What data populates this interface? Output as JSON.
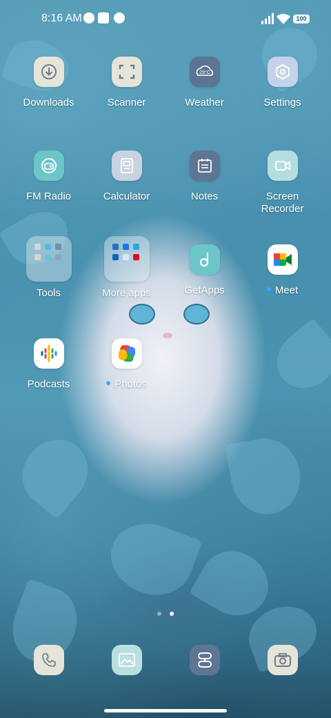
{
  "status_bar": {
    "time": "8:16 AM",
    "battery": "100",
    "icons": [
      "notification-circle-icon",
      "notification-square-icon",
      "notification-circle-icon",
      "signal-icon",
      "wifi-icon",
      "battery-icon"
    ]
  },
  "apps": [
    {
      "label": "Downloads",
      "icon": "download-icon",
      "bg": "#e5e4d8"
    },
    {
      "label": "Scanner",
      "icon": "scanner-icon",
      "bg": "#e5e4d8"
    },
    {
      "label": "Weather",
      "icon": "weather-icon",
      "bg": "#5d7592",
      "temp": "29°C"
    },
    {
      "label": "Settings",
      "icon": "settings-icon",
      "bg": "#c5d2ea"
    },
    {
      "label": "FM Radio",
      "icon": "radio-icon",
      "bg": "#6cc5c8"
    },
    {
      "label": "Calculator",
      "icon": "calculator-icon",
      "bg": "#c9d2e0"
    },
    {
      "label": "Notes",
      "icon": "notes-icon",
      "bg": "#5e7594"
    },
    {
      "label": "Screen Recorder",
      "label_line1": "Screen",
      "label_line2": "Recorder",
      "icon": "screen-recorder-icon",
      "bg": "#b5dde0"
    },
    {
      "label": "Tools",
      "icon": "tools-folder-icon"
    },
    {
      "label": "More apps",
      "icon": "more-apps-folder-icon"
    },
    {
      "label": "GetApps",
      "icon": "getapps-icon",
      "bg": "#6cc5c8"
    },
    {
      "label": "Meet",
      "icon": "google-meet-icon",
      "bg": "#ffffff",
      "new_dot": true
    },
    {
      "label": "Podcasts",
      "icon": "google-podcasts-icon",
      "bg": "#ffffff"
    },
    {
      "label": "Photos",
      "icon": "google-photos-icon",
      "bg": "#ffffff",
      "new_dot": true
    }
  ],
  "pager": {
    "pages": 2,
    "current": 2
  },
  "dock": [
    {
      "name": "phone",
      "icon": "phone-icon",
      "bg": "#e5e4d8"
    },
    {
      "name": "gallery",
      "icon": "gallery-icon",
      "bg": "#b9dfe2"
    },
    {
      "name": "browser",
      "icon": "browser-icon",
      "bg": "#5e7594"
    },
    {
      "name": "camera",
      "icon": "camera-icon",
      "bg": "#e5e4d8"
    }
  ],
  "colors": {
    "accent_dot": "#3ba5ff"
  }
}
